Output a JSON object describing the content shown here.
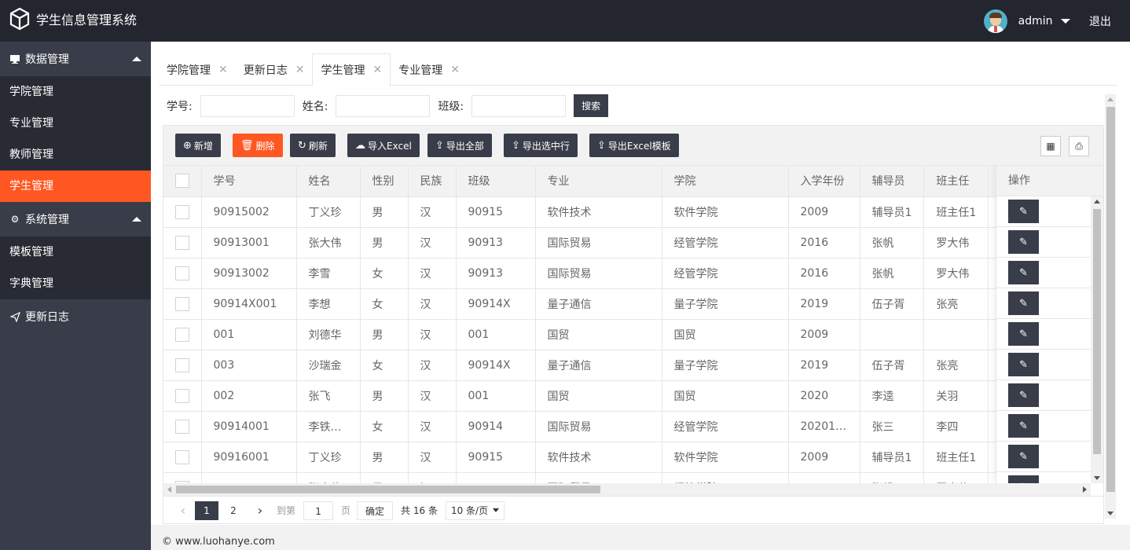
{
  "header": {
    "title": "学生信息管理系统",
    "username": "admin",
    "logout": "退出"
  },
  "sidebar": {
    "groups": [
      {
        "label": "数据管理",
        "icon": "monitor-icon",
        "items": [
          "学院管理",
          "专业管理",
          "教师管理",
          "学生管理"
        ]
      },
      {
        "label": "系统管理",
        "icon": "gear-icon",
        "items": [
          "模板管理",
          "字典管理"
        ]
      }
    ],
    "active_item": "学生管理",
    "log": "更新日志"
  },
  "tabs": [
    {
      "label": "学院管理"
    },
    {
      "label": "更新日志"
    },
    {
      "label": "学生管理",
      "active": true
    },
    {
      "label": "专业管理"
    }
  ],
  "search": {
    "student_no_label": "学号:",
    "name_label": "姓名:",
    "class_label": "班级:",
    "button": "搜索"
  },
  "toolbar": {
    "add": "新增",
    "delete": "删除",
    "refresh": "刷新",
    "import_excel": "导入Excel",
    "export_all": "导出全部",
    "export_selected": "导出选中行",
    "export_template": "导出Excel模板"
  },
  "table": {
    "columns": [
      "学号",
      "姓名",
      "性别",
      "民族",
      "班级",
      "专业",
      "学院",
      "入学年份",
      "辅导员",
      "班主任"
    ],
    "ops_header": "操作",
    "rows": [
      [
        "90915002",
        "丁义珍",
        "男",
        "汉",
        "90915",
        "软件技术",
        "软件学院",
        "2009",
        "辅导员1",
        "班主任1"
      ],
      [
        "90913001",
        "张大伟",
        "男",
        "汉",
        "90913",
        "国际贸易",
        "经管学院",
        "2016",
        "张帆",
        "罗大伟"
      ],
      [
        "90913002",
        "李雪",
        "女",
        "汉",
        "90913",
        "国际贸易",
        "经管学院",
        "2016",
        "张帆",
        "罗大伟"
      ],
      [
        "90914X001",
        "李想",
        "女",
        "汉",
        "90914X",
        "量子通信",
        "量子学院",
        "2019",
        "伍子胥",
        "张亮"
      ],
      [
        "001",
        "刘德华",
        "男",
        "汉",
        "001",
        "国贸",
        "国贸",
        "2009",
        "",
        ""
      ],
      [
        "003",
        "沙瑞金",
        "女",
        "汉",
        "90914X",
        "量子通信",
        "量子学院",
        "2019",
        "伍子胥",
        "张亮"
      ],
      [
        "002",
        "张飞",
        "男",
        "汉",
        "001",
        "国贸",
        "国贸",
        "2020",
        "李逵",
        "关羽"
      ],
      [
        "90914001",
        "李铁…",
        "女",
        "汉",
        "90914",
        "国际贸易",
        "经管学院",
        "20201…",
        "张三",
        "李四"
      ],
      [
        "90916001",
        "丁义珍",
        "男",
        "汉",
        "90915",
        "软件技术",
        "软件学院",
        "2009",
        "辅导员1",
        "班主任1"
      ],
      [
        "",
        "张大伟",
        "男",
        "汉",
        "",
        "国际贸易",
        "经管学院",
        "",
        "张帆",
        "罗大伟"
      ]
    ]
  },
  "pager": {
    "current": "1",
    "next_page": "2",
    "goto_label": "到第",
    "goto_value": "1",
    "page_unit": "页",
    "confirm": "确定",
    "total": "共 16 条",
    "limit": "10 条/页"
  },
  "footer": {
    "copyright": "© www.luohanye.com"
  }
}
